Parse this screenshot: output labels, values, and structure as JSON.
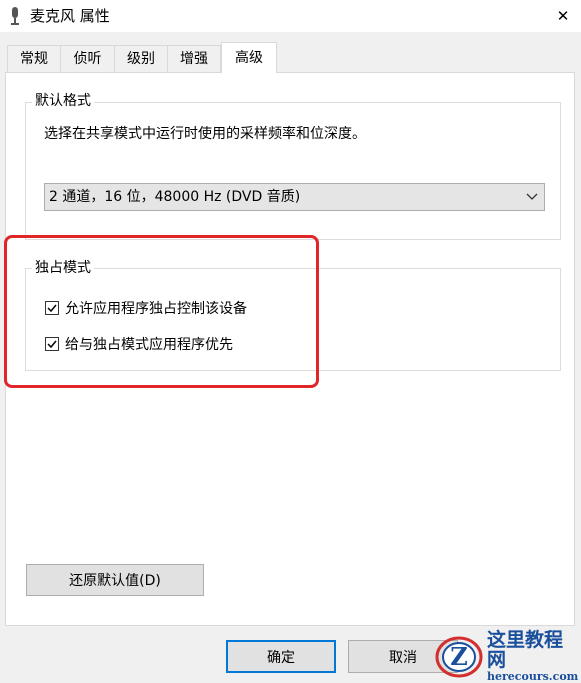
{
  "window": {
    "title": "麦克风 属性",
    "close_symbol": "✕",
    "icon": "microphone-icon"
  },
  "tabs": [
    {
      "label": "常规",
      "active": false
    },
    {
      "label": "侦听",
      "active": false
    },
    {
      "label": "级别",
      "active": false
    },
    {
      "label": "增强",
      "active": false
    },
    {
      "label": "高级",
      "active": true
    }
  ],
  "default_format": {
    "title": "默认格式",
    "description": "选择在共享模式中运行时使用的采样频率和位深度。",
    "selected_value": "2 通道，16 位，48000 Hz (DVD 音质)"
  },
  "exclusive_mode": {
    "title": "独占模式",
    "options": [
      {
        "label": "允许应用程序独占控制该设备",
        "checked": true
      },
      {
        "label": "给与独占模式应用程序优先",
        "checked": true
      }
    ]
  },
  "buttons": {
    "restore_defaults": "还原默认值(D)",
    "ok": "确定",
    "cancel": "取消"
  },
  "watermark": {
    "title": "这里教程网",
    "subtitle": "herecours.com",
    "letter": "Z"
  },
  "colors": {
    "highlight": "#e0262a",
    "focus_border": "#0078d7",
    "watermark_blue": "#1a4f9c"
  }
}
